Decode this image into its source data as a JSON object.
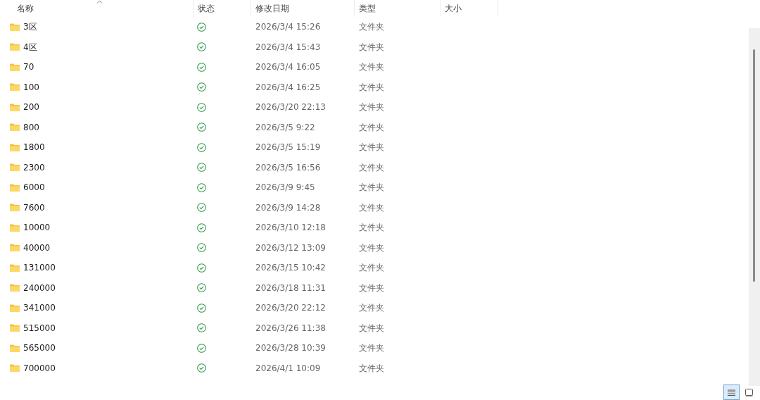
{
  "columns": [
    {
      "label": "名称",
      "sorted": true
    },
    {
      "label": "状态",
      "sorted": false
    },
    {
      "label": "修改日期",
      "sorted": false
    },
    {
      "label": "类型",
      "sorted": false
    },
    {
      "label": "大小",
      "sorted": false
    }
  ],
  "rows": [
    {
      "name": "3区",
      "synced": true,
      "modified": "2026/3/4 15:26",
      "type": "文件夹"
    },
    {
      "name": "4区",
      "synced": true,
      "modified": "2026/3/4 15:43",
      "type": "文件夹"
    },
    {
      "name": "70",
      "synced": true,
      "modified": "2026/3/4 16:05",
      "type": "文件夹"
    },
    {
      "name": "100",
      "synced": true,
      "modified": "2026/3/4 16:25",
      "type": "文件夹"
    },
    {
      "name": "200",
      "synced": true,
      "modified": "2026/3/20 22:13",
      "type": "文件夹"
    },
    {
      "name": "800",
      "synced": true,
      "modified": "2026/3/5 9:22",
      "type": "文件夹"
    },
    {
      "name": "1800",
      "synced": true,
      "modified": "2026/3/5 15:19",
      "type": "文件夹"
    },
    {
      "name": "2300",
      "synced": true,
      "modified": "2026/3/5 16:56",
      "type": "文件夹"
    },
    {
      "name": "6000",
      "synced": true,
      "modified": "2026/3/9 9:45",
      "type": "文件夹"
    },
    {
      "name": "7600",
      "synced": true,
      "modified": "2026/3/9 14:28",
      "type": "文件夹"
    },
    {
      "name": "10000",
      "synced": true,
      "modified": "2026/3/10 12:18",
      "type": "文件夹"
    },
    {
      "name": "40000",
      "synced": true,
      "modified": "2026/3/12 13:09",
      "type": "文件夹"
    },
    {
      "name": "131000",
      "synced": true,
      "modified": "2026/3/15 10:42",
      "type": "文件夹"
    },
    {
      "name": "240000",
      "synced": true,
      "modified": "2026/3/18 11:31",
      "type": "文件夹"
    },
    {
      "name": "341000",
      "synced": true,
      "modified": "2026/3/20 22:12",
      "type": "文件夹"
    },
    {
      "name": "515000",
      "synced": true,
      "modified": "2026/3/26 11:38",
      "type": "文件夹"
    },
    {
      "name": "565000",
      "synced": true,
      "modified": "2026/3/28 10:39",
      "type": "文件夹"
    },
    {
      "name": "700000",
      "synced": true,
      "modified": "2026/4/1 10:09",
      "type": "文件夹"
    }
  ],
  "view_buttons": [
    {
      "kind": "details",
      "selected": true
    },
    {
      "kind": "tiles",
      "selected": false
    }
  ]
}
